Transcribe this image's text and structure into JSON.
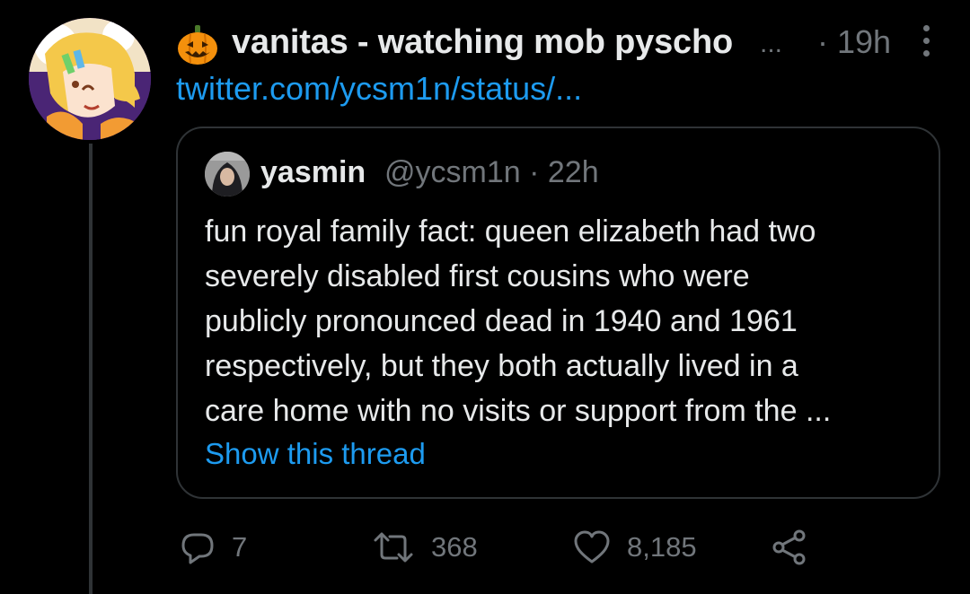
{
  "tweet": {
    "display_name": "vanitas - watching mob pyscho",
    "name_ellipsis": "...",
    "time": "· 19h",
    "link": "twitter.com/ycsm1n/status/...",
    "avatar_icon": "anime-avatar",
    "emoji_icon": "jack-o-lantern-icon"
  },
  "quote": {
    "name": "yasmin",
    "handle_time": "@ycsm1n · 22h",
    "lines": [
      "fun royal family fact: queen elizabeth had two",
      "severely disabled first cousins who were",
      "publicly pronounced dead in 1940 and 1961",
      "respectively, but they both actually lived in a",
      "care home with no visits or support from the ..."
    ],
    "show_thread": "Show this thread"
  },
  "actions": {
    "reply_count": "7",
    "retweet_count": "368",
    "like_count": "8,185"
  },
  "colors": {
    "background": "#000000",
    "text": "#e7e9ea",
    "secondary": "#71767b",
    "link": "#1d9bf0",
    "border": "#2f3336"
  }
}
